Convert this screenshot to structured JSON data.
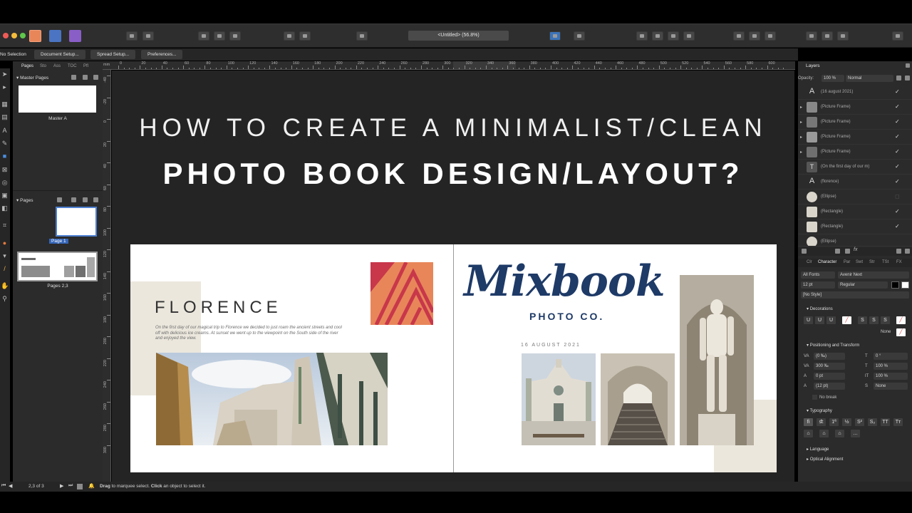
{
  "app": {
    "window_title": "<Untitled> (56.8%)",
    "colors": {
      "panel_bg": "#2b2b2b",
      "canvas_bg": "#242424",
      "accent_logo": "#1e3a67",
      "beige": "#ebe7dd",
      "publisher_orange": "#e8865a",
      "publisher_red": "#c8374a"
    }
  },
  "context_bar": {
    "selection_label": "No Selection",
    "document_setup": "Document Setup...",
    "spread_setup": "Spread Setup...",
    "preferences": "Preferences..."
  },
  "pages_panel": {
    "tabs": [
      "Pages",
      "Sto",
      "Ass",
      "TOC",
      "Pfl"
    ],
    "master_header": "Master Pages",
    "master_label": "Master A",
    "pages_header": "Pages",
    "page1_label": "Page 1",
    "pages23_label": "Pages 2,3"
  },
  "rulers": {
    "unit": "mm",
    "top_labels": [
      "0",
      "20",
      "40",
      "60",
      "80",
      "100",
      "120",
      "140",
      "160",
      "180",
      "200",
      "220",
      "240",
      "260",
      "280",
      "300",
      "320",
      "340",
      "360",
      "380",
      "400",
      "420",
      "440",
      "460",
      "480",
      "500",
      "520",
      "540",
      "560",
      "580",
      "600"
    ],
    "left_labels": [
      "-40",
      "-20",
      "0",
      "20",
      "40",
      "60",
      "80",
      "100",
      "120",
      "140",
      "160",
      "180",
      "200",
      "220",
      "240",
      "260",
      "280",
      "300"
    ]
  },
  "overlay": {
    "line1": "HOW TO CREATE A MINIMALIST/CLEAN",
    "line2": "PHOTO BOOK DESIGN/LAYOUT?"
  },
  "spread": {
    "heading": "FLORENCE",
    "body": "On the first day of our magical trip to Florence we decided to just roam the ancient streets and cool off with delicious ice creams. At sunset we went up to the viewpoint on the South side of the river and enjoyed the view.",
    "date": "16 AUGUST 2021",
    "logo_main": "Mixbook",
    "logo_sub": "PHOTO CO."
  },
  "layers_panel": {
    "title": "Layers",
    "opacity_label": "Opacity:",
    "opacity_value": "100 %",
    "blend_mode": "Normal",
    "layers": [
      {
        "name": "(16 august 2021)",
        "icon": "text-icon",
        "checked": true
      },
      {
        "name": "(Picture Frame)",
        "icon": "picture-frame-icon",
        "checked": true
      },
      {
        "name": "(Picture Frame)",
        "icon": "picture-frame-icon",
        "checked": true
      },
      {
        "name": "(Picture Frame)",
        "icon": "picture-frame-icon",
        "checked": true
      },
      {
        "name": "(Picture Frame)",
        "icon": "picture-frame-icon",
        "checked": true
      },
      {
        "name": "(On the first day of our m)",
        "icon": "frame-text-icon",
        "checked": true
      },
      {
        "name": "(florence)",
        "icon": "text-icon",
        "checked": true
      },
      {
        "name": "(Ellipse)",
        "icon": "ellipse-icon",
        "checked": false
      },
      {
        "name": "(Rectangle)",
        "icon": "rectangle-icon",
        "checked": true
      },
      {
        "name": "(Rectangle)",
        "icon": "rectangle-icon",
        "checked": true
      },
      {
        "name": "(Ellipse)",
        "icon": "ellipse-icon",
        "checked": false
      }
    ]
  },
  "character_panel": {
    "tabs": [
      "Clr",
      "Character",
      "Par",
      "Swt",
      "Str",
      "TSt",
      "FX"
    ],
    "font_collection": "All Fonts",
    "font_family": "Avenir Next",
    "font_size": "12 pt",
    "font_style": "Regular",
    "char_style": "[No Style]",
    "decorations_title": "Decorations",
    "none_label": "None",
    "positioning_title": "Positioning and Transform",
    "kerning": "(0 ‰)",
    "tracking": "300 ‰",
    "baseline": "0 pt",
    "leading": "(12 pt)",
    "skew": "0 °",
    "scale_h": "100 %",
    "scale_v": "100 %",
    "case": "None",
    "no_break": "No break",
    "typography_title": "Typography",
    "language_title": "Language",
    "optical_title": "Optical Alignment"
  },
  "status_bar": {
    "page_indicator": "2,3 of 3",
    "hint_bold1": "Drag",
    "hint_text1": " to marquee select. ",
    "hint_bold2": "Click",
    "hint_text2": " an object to select it."
  }
}
